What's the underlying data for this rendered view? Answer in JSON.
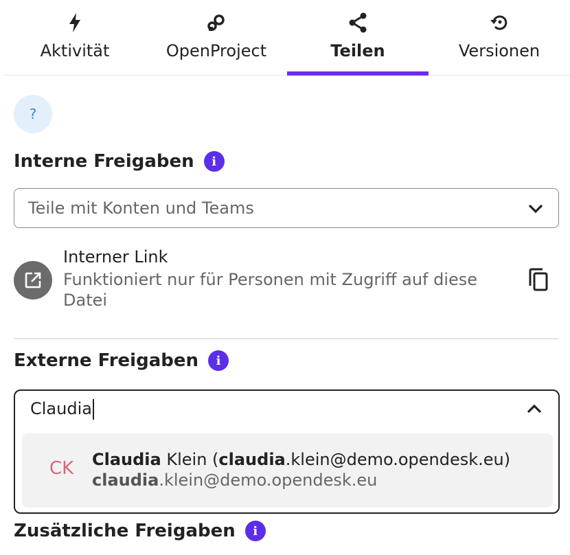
{
  "tabs": [
    {
      "label": "Aktivität",
      "icon": "lightning-icon",
      "active": false
    },
    {
      "label": "OpenProject",
      "icon": "openproject-icon",
      "active": false
    },
    {
      "label": "Teilen",
      "icon": "share-icon",
      "active": true
    },
    {
      "label": "Versionen",
      "icon": "history-icon",
      "active": false
    }
  ],
  "help": {
    "label": "?"
  },
  "internal": {
    "title": "Interne Freigaben",
    "select_placeholder": "Teile mit Konten und Teams",
    "link_title": "Interner Link",
    "link_description": "Funktioniert nur für Personen mit Zugriff auf diese Datei"
  },
  "external": {
    "title": "Externe Freigaben",
    "search_value": "Claudia",
    "suggestion": {
      "initials": "CK",
      "name_match": "Claudia",
      "name_rest": " Klein (",
      "email_match": "claudia",
      "email_rest": ".klein@demo.opendesk.eu",
      "close": ")"
    }
  },
  "additional": {
    "title": "Zusätzliche Freigaben"
  },
  "colors": {
    "accent": "#6e2cf0",
    "info": "#5b2ee8",
    "help_bg": "#e3f0fb",
    "avatar_text": "#d9657a"
  }
}
